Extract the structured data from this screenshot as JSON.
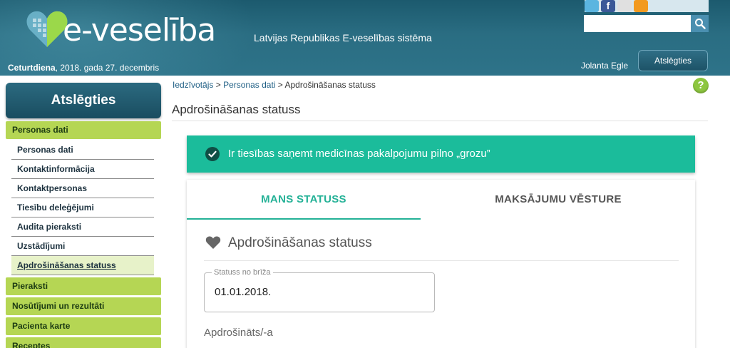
{
  "header": {
    "logo_text": "e-veselība",
    "tagline": "Latvijas Republikas E-veselības sistēma",
    "date_day": "Ceturtdiena",
    "date_rest": ", 2018. gada 27. decembris",
    "user_name": "Jolanta Egle",
    "logout_label": "Atslēgties",
    "search_placeholder": "",
    "social_icons": [
      "twitter-icon",
      "facebook-icon",
      "draugiem-icon",
      "rss-icon"
    ]
  },
  "sidebar": {
    "logout_label": "Atslēgties",
    "sections": [
      {
        "label": "Personas dati",
        "items": [
          "Personas dati",
          "Kontaktinformācija",
          "Kontaktpersonas",
          "Tiesību deleģējumi",
          "Audita pieraksti",
          "Uzstādījumi",
          "Apdrošināšanas statuss"
        ],
        "active_item": "Apdrošināšanas statuss"
      },
      {
        "label": "Pieraksti"
      },
      {
        "label": "Nosūtījumi un rezultāti"
      },
      {
        "label": "Pacienta karte"
      },
      {
        "label": "Receptes"
      }
    ]
  },
  "main": {
    "breadcrumb": {
      "home": "Iedzīvotājs",
      "sep": " > ",
      "parent": "Personas dati",
      "current": "Apdrošināšanas statuss"
    },
    "help_label": "?",
    "page_title": "Apdrošināšanas statuss",
    "banner_text": "Ir tiesības saņemt medicīnas pakalpojumu pilno „grozu”",
    "tabs": [
      {
        "label": "MANS STATUSS",
        "active": true
      },
      {
        "label": "MAKSĀJUMU VĒSTURE",
        "active": false
      }
    ],
    "section_title": "Apdrošināšanas statuss",
    "field": {
      "label": "Statuss no brīža",
      "value": "01.01.2018."
    },
    "sub_label": "Apdrošināts/-a"
  },
  "colors": {
    "header": "#2a6d82",
    "nav_green": "#b5d654",
    "banner": "#1bbc9b",
    "tab_active": "#23b196"
  }
}
